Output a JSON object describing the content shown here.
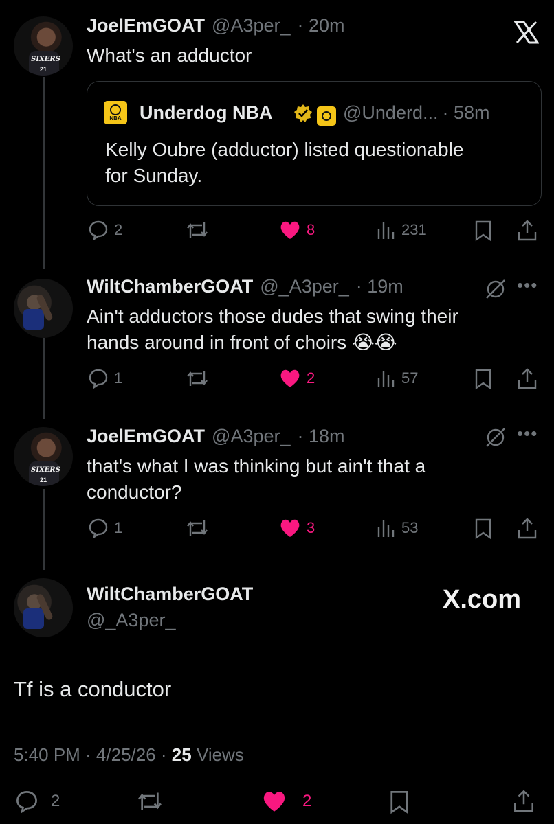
{
  "tweets": [
    {
      "name": "JoelEmGOAT",
      "handle": "@A3per_",
      "time": "· 20m",
      "text": "What's an adductor",
      "quote": {
        "name": "Underdog NBA",
        "handle": "@Underd...",
        "time": "· 58m",
        "text_line1": "Kelly Oubre (adductor) listed questionable",
        "text_line2": "for Sunday.",
        "badge": "NBA"
      },
      "replies": "2",
      "likes": "8",
      "views": "231"
    },
    {
      "name": "WiltChamberGOAT",
      "handle": "@_A3per_",
      "time": "· 19m",
      "text_line1": "Ain't adductors those dudes that swing their",
      "text_line2": "hands around in front of choirs 😭😭",
      "replies": "1",
      "likes": "2",
      "views": "57"
    },
    {
      "name": "JoelEmGOAT",
      "handle": "@A3per_",
      "time": "· 18m",
      "text_line1": "that's what I was thinking but ain't that a",
      "text_line2": "conductor?",
      "replies": "1",
      "likes": "3",
      "views": "53"
    }
  ],
  "main": {
    "name": "WiltChamberGOAT",
    "handle": "@_A3per_",
    "watermark": "X.com",
    "text": "Tf is a conductor",
    "timestamp": "5:40 PM · 4/25/26 · ",
    "views_count": "25",
    "views_label": " Views",
    "replies": "2",
    "likes": "2"
  },
  "jersey": {
    "team": "SIXERS",
    "number": "21"
  },
  "icons": {
    "close": "x-logo-icon",
    "reply": "speech-bubble-icon",
    "repost": "repost-arrows-icon",
    "like": "heart-icon",
    "views": "bar-chart-icon",
    "bookmark": "bookmark-icon",
    "share": "share-upload-icon",
    "grok": "grok-slash-icon",
    "more": "ellipsis-icon"
  },
  "colors": {
    "background": "#000000",
    "text": "#e7e9ea",
    "muted": "#71767b",
    "like": "#f91880",
    "nba_yellow": "#f5c518"
  }
}
